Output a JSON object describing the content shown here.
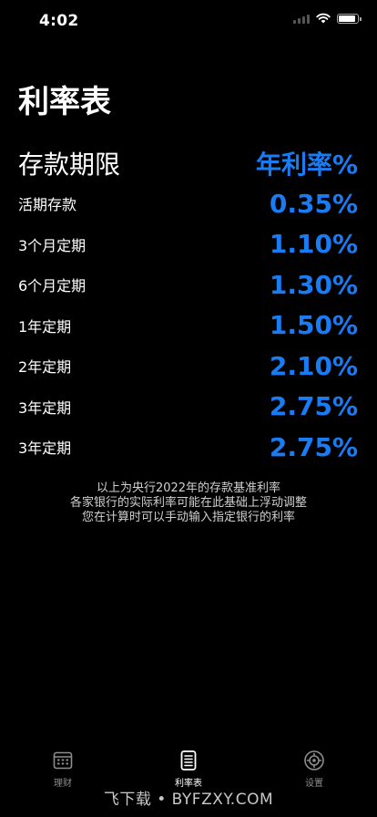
{
  "status_bar": {
    "time": "4:02",
    "battery_level": 0.9
  },
  "page": {
    "title": "利率表"
  },
  "table": {
    "header": {
      "term": "存款期限",
      "rate": "年利率%"
    },
    "rows": [
      {
        "term": "活期存款",
        "rate": "0.35%"
      },
      {
        "term": "3个月定期",
        "rate": "1.10%"
      },
      {
        "term": "6个月定期",
        "rate": "1.30%"
      },
      {
        "term": "1年定期",
        "rate": "1.50%"
      },
      {
        "term": "2年定期",
        "rate": "2.10%"
      },
      {
        "term": "3年定期",
        "rate": "2.75%"
      },
      {
        "term": "3年定期",
        "rate": "2.75%"
      }
    ]
  },
  "note": {
    "line1": "以上为央行2022年的存款基准利率",
    "line2": "各家银行的实际利率可能在此基础上浮动调整",
    "line3": "您在计算时可以手动输入指定银行的利率"
  },
  "tabs": [
    {
      "label": "理财",
      "icon": "calculator-icon",
      "active": false
    },
    {
      "label": "利率表",
      "icon": "document-list-icon",
      "active": true
    },
    {
      "label": "设置",
      "icon": "gear-icon",
      "active": false
    }
  ],
  "watermark": {
    "text": "飞下载 • BYFZXY.COM"
  },
  "colors": {
    "background": "#000000",
    "accent": "#1a7cf3",
    "text": "#ffffff",
    "inactive_tab": "#8e8e8e"
  }
}
